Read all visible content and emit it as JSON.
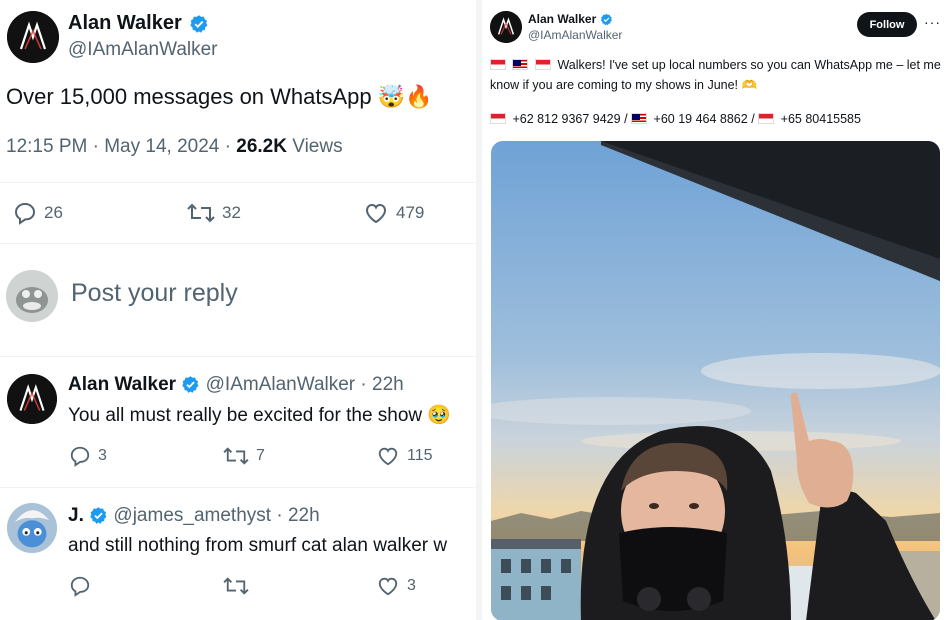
{
  "main_tweet": {
    "author_name": "Alan Walker",
    "author_handle": "@IAmAlanWalker",
    "text": "Over 15,000 messages on WhatsApp 🤯🔥",
    "time": "12:15 PM",
    "date": "May 14, 2024",
    "views_count": "26.2K",
    "views_label": "Views",
    "replies": "26",
    "retweets": "32",
    "likes": "479"
  },
  "reply_box": {
    "placeholder": "Post your reply"
  },
  "replies": [
    {
      "author_name": "Alan Walker",
      "author_handle": "@IAmAlanWalker",
      "time": "22h",
      "text": "You all must really be excited for the show 🥹",
      "replies": "3",
      "retweets": "7",
      "likes": "115"
    },
    {
      "author_name": "J.",
      "author_handle": "@james_amethyst",
      "time": "22h",
      "text": "and still nothing from smurf cat alan walker w",
      "replies": "",
      "retweets": "",
      "likes": "3"
    }
  ],
  "right_post": {
    "author_name": "Alan Walker",
    "author_handle": "@IAmAlanWalker",
    "follow_label": "Follow",
    "more_label": "···",
    "text": "Walkers! I've set up local numbers so you can WhatsApp me – let me know if you are coming to my shows in June! 🫶",
    "phone_id": "+62 812 9367 9429",
    "phone_my": "+60 19 464 8862",
    "phone_sg": "+65 80415585",
    "separator": "/"
  },
  "colors": {
    "verified": "#1d9bf0",
    "text": "#0f1419",
    "muted": "#536471",
    "divider": "#eff3f4"
  }
}
